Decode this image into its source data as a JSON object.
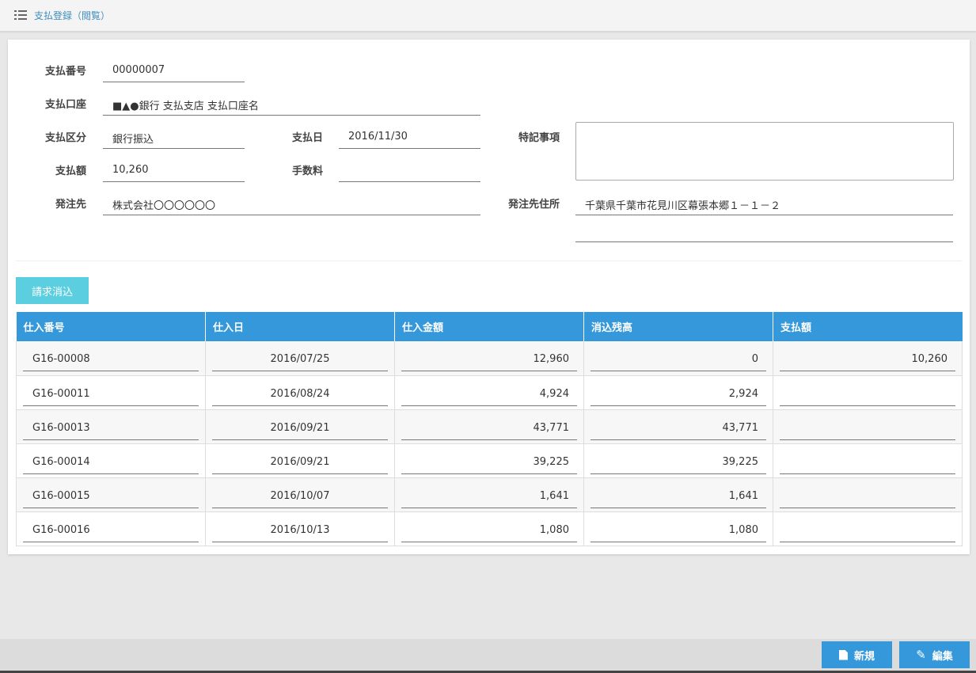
{
  "header": {
    "title": "支払登録（閲覧）",
    "icon": "list-icon"
  },
  "form": {
    "payment_number": {
      "label": "支払番号",
      "value": "00000007"
    },
    "payment_account": {
      "label": "支払口座",
      "value": "■▲●銀行 支払支店 支払口座名"
    },
    "payment_type": {
      "label": "支払区分",
      "value": "銀行振込"
    },
    "payment_date": {
      "label": "支払日",
      "value": "2016/11/30"
    },
    "special_notes": {
      "label": "特記事項",
      "value": ""
    },
    "payment_amount": {
      "label": "支払額",
      "value": "10,260"
    },
    "fee": {
      "label": "手数料",
      "value": ""
    },
    "vendor": {
      "label": "発注先",
      "value": "株式会社〇〇〇〇〇〇"
    },
    "vendor_address": {
      "label": "発注先住所",
      "line1": "千葉県千葉市花見川区幕張本郷１－１－２",
      "line2": ""
    }
  },
  "invoice_button": {
    "label": "請求消込"
  },
  "table": {
    "columns": [
      "仕入番号",
      "仕入日",
      "仕入金額",
      "消込残高",
      "支払額"
    ],
    "rows": [
      [
        "G16-00008",
        "2016/07/25",
        "12,960",
        "0",
        "10,260"
      ],
      [
        "G16-00011",
        "2016/08/24",
        "4,924",
        "2,924",
        ""
      ],
      [
        "G16-00013",
        "2016/09/21",
        "43,771",
        "43,771",
        ""
      ],
      [
        "G16-00014",
        "2016/09/21",
        "39,225",
        "39,225",
        ""
      ],
      [
        "G16-00015",
        "2016/10/07",
        "1,641",
        "1,641",
        ""
      ],
      [
        "G16-00016",
        "2016/10/13",
        "1,080",
        "1,080",
        ""
      ]
    ]
  },
  "footer": {
    "new_button": {
      "label": "新規",
      "icon": "document-icon"
    },
    "edit_button": {
      "label": "編集",
      "icon": "pencil-icon"
    }
  },
  "colors": {
    "accent": "#3498db",
    "secondary_button": "#5bcfe0",
    "header_text": "#3c8dbc"
  }
}
